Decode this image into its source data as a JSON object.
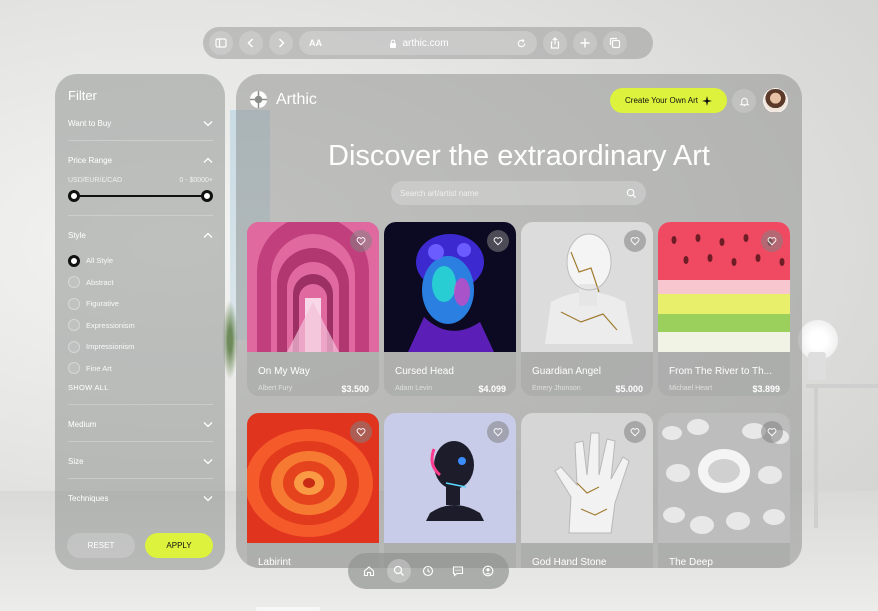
{
  "browser": {
    "url": "arthic.com",
    "text_size_label": "AA",
    "icons": [
      "sidebar-icon",
      "back-icon",
      "forward-icon",
      "lock-icon",
      "reload-icon",
      "share-icon",
      "new-tab-icon",
      "tabs-icon"
    ]
  },
  "filter": {
    "title": "Filter",
    "want_to_buy": "Want to Buy",
    "price_range": {
      "label": "Price Range",
      "currency": "USD/EUR/£/CAD",
      "range": "0 - $0000+",
      "min_fraction": 0,
      "max_fraction": 1
    },
    "style": {
      "label": "Style",
      "options": [
        {
          "label": "All Style",
          "selected": true
        },
        {
          "label": "Abstract",
          "selected": false
        },
        {
          "label": "Figurative",
          "selected": false
        },
        {
          "label": "Expressionism",
          "selected": false
        },
        {
          "label": "Impressionism",
          "selected": false
        },
        {
          "label": "Fine Art",
          "selected": false
        }
      ],
      "show_all": "SHOW ALL"
    },
    "medium": "Medium",
    "size": "Size",
    "techniques": "Techniques",
    "reset_label": "RESET",
    "apply_label": "APPLY"
  },
  "header": {
    "brand": "Arthic",
    "create_label": "Create Your Own Art",
    "hero_title": "Discover the extraordinary Art",
    "search_placeholder": "Search art/artist name"
  },
  "artworks": [
    {
      "title": "On My Way",
      "artist": "Albert Fury",
      "price": "$3.500"
    },
    {
      "title": "Cursed Head",
      "artist": "Adam Levin",
      "price": "$4.099"
    },
    {
      "title": "Guardian Angel",
      "artist": "Emery Jhonson",
      "price": "$5.000"
    },
    {
      "title": "From The River to Th...",
      "artist": "Michael Heart",
      "price": "$3.899"
    },
    {
      "title": "Labirint",
      "artist": "",
      "price": ""
    },
    {
      "title": "",
      "artist": "",
      "price": ""
    },
    {
      "title": "God Hand Stone",
      "artist": "",
      "price": ""
    },
    {
      "title": "The Deep",
      "artist": "",
      "price": ""
    }
  ],
  "colors": {
    "accent": "#dcf23c",
    "panel": "#8c8e8c"
  },
  "bottom_nav": [
    "home-icon",
    "search-icon",
    "history-icon",
    "chat-icon",
    "profile-icon"
  ]
}
